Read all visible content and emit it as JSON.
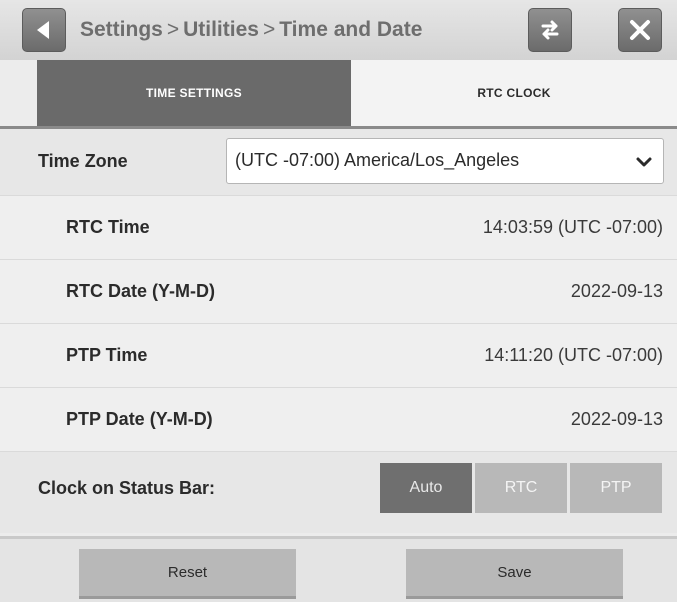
{
  "header": {
    "breadcrumb": [
      "Settings",
      "Utilities",
      "Time and Date"
    ],
    "separator": ">",
    "icons": {
      "back": "back-arrow-icon",
      "swap": "swap-arrows-icon",
      "close": "close-icon"
    }
  },
  "tabs": [
    {
      "label": "TIME SETTINGS",
      "active": true
    },
    {
      "label": "RTC CLOCK",
      "active": false
    }
  ],
  "time_zone": {
    "label": "Time Zone",
    "value": "(UTC -07:00) America/Los_Angeles"
  },
  "rows": [
    {
      "label": "RTC Time",
      "value": "14:03:59 (UTC -07:00)"
    },
    {
      "label": "RTC Date (Y-M-D)",
      "value": "2022-09-13"
    },
    {
      "label": "PTP Time",
      "value": "14:11:20 (UTC -07:00)"
    },
    {
      "label": "PTP Date (Y-M-D)",
      "value": "2022-09-13"
    }
  ],
  "status_bar_clock": {
    "label": "Clock on Status Bar:",
    "options": [
      "Auto",
      "RTC",
      "PTP"
    ],
    "selected": "Auto"
  },
  "footer": {
    "reset_label": "Reset",
    "save_label": "Save"
  },
  "colors": {
    "active_tab": "#6a6a6a",
    "selected_segment": "#6f6f6f",
    "button": "#b8b8b8"
  }
}
